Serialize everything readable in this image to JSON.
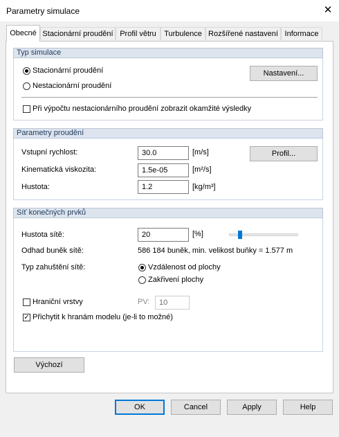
{
  "window": {
    "title": "Parametry simulace"
  },
  "tabs": [
    {
      "label": "Obecné"
    },
    {
      "label": "Stacionární proudění"
    },
    {
      "label": "Profil větru"
    },
    {
      "label": "Turbulence"
    },
    {
      "label": "Rozšířené nastavení"
    },
    {
      "label": "Informace"
    }
  ],
  "sim_type": {
    "header": "Typ simulace",
    "options": [
      "Stacionární proudění",
      "Nestacionární proudění"
    ],
    "selected": "Stacionární proudění",
    "settings_button": "Nastavení...",
    "show_results_label": "Při výpočtu nestacionárního proudění zobrazit okamžité výsledky"
  },
  "flow_params": {
    "header": "Parametry proudění",
    "inlet_velocity": {
      "label": "Vstupní rychlost:",
      "value": "30.0",
      "unit": "[m/s]"
    },
    "kinematic_viscosity": {
      "label": "Kinematická viskozita:",
      "value": "1.5e-05",
      "unit": "[m²/s]"
    },
    "density": {
      "label": "Hustota:",
      "value": "1.2",
      "unit": "[kg/m³]"
    },
    "profile_button": "Profil..."
  },
  "mesh": {
    "header": "Síť konečných prvků",
    "density": {
      "label": "Hustota sítě:",
      "value": "20",
      "unit": "[%]"
    },
    "slider_level": 0.2,
    "cell_estimate": {
      "label": "Odhad buněk sítě:",
      "value": "586 184 buněk, min. velikost buňky = 1.577 m"
    },
    "refinement": {
      "label": "Typ zahuštění sítě:",
      "options": [
        "Vzdálenost od plochy",
        "Zakřivení plochy"
      ],
      "selected": "Vzdálenost od plochy"
    },
    "boundary_layers": {
      "label": "Hraniční vrstvy",
      "checked": false,
      "pv_label": "PV:",
      "pv_value": "10"
    },
    "snap_to_edges": {
      "label": "Přichytit k hranám modelu (je-li to možné)",
      "checked": true
    }
  },
  "footer": {
    "default_button": "Výchozí",
    "ok": "OK",
    "cancel": "Cancel",
    "apply": "Apply",
    "help": "Help"
  },
  "colors": {
    "accent": "#0078d7",
    "group_header_bg": "#dde4ee",
    "dialog_bg": "#f0f0f0"
  }
}
